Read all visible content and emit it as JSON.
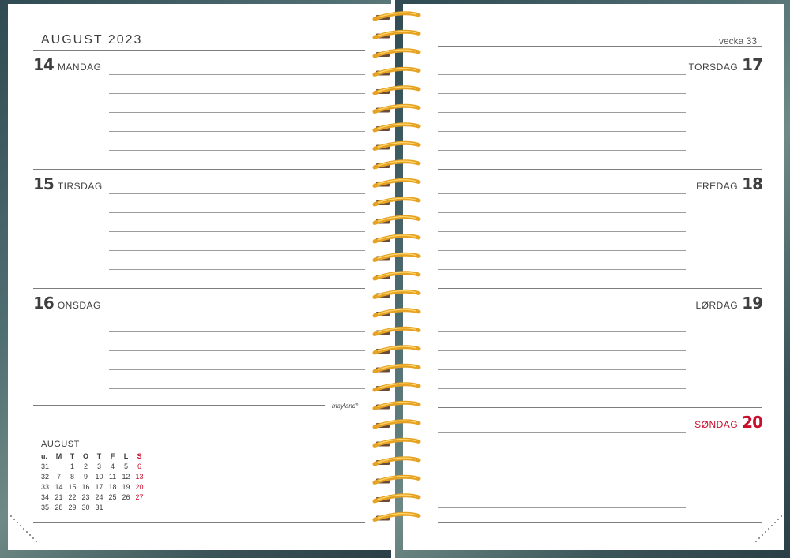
{
  "left_page": {
    "month_title": "AUGUST 2023",
    "brand": "mayland°",
    "days": [
      {
        "num": "14",
        "name": "MANDAG"
      },
      {
        "num": "15",
        "name": "TIRSDAG"
      },
      {
        "num": "16",
        "name": "ONSDAG"
      }
    ]
  },
  "right_page": {
    "week_label": "vecka 33",
    "days": [
      {
        "num": "17",
        "name": "TORSDAG"
      },
      {
        "num": "18",
        "name": "FREDAG"
      },
      {
        "num": "19",
        "name": "LØRDAG"
      },
      {
        "num": "20",
        "name": "SØNDAG"
      }
    ]
  },
  "mini_calendar": {
    "title": "AUGUST",
    "headers": [
      "u.",
      "M",
      "T",
      "O",
      "T",
      "F",
      "L",
      "S"
    ],
    "rows": [
      [
        "31",
        "",
        "1",
        "2",
        "3",
        "4",
        "5",
        "6"
      ],
      [
        "32",
        "7",
        "8",
        "9",
        "10",
        "11",
        "12",
        "13"
      ],
      [
        "33",
        "14",
        "15",
        "16",
        "17",
        "18",
        "19",
        "20"
      ],
      [
        "34",
        "21",
        "22",
        "23",
        "24",
        "25",
        "26",
        "27"
      ],
      [
        "35",
        "28",
        "29",
        "30",
        "31",
        "",
        "",
        ""
      ]
    ]
  },
  "colors": {
    "cover": "#3b5459",
    "sunday": "#c8102e",
    "spiral": "#e6a323",
    "text": "#3f3f3f"
  }
}
